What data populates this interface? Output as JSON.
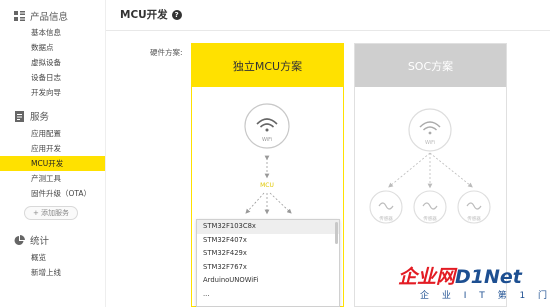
{
  "page": {
    "title": "MCU开发"
  },
  "sidebar": {
    "sections": [
      {
        "title": "产品信息",
        "icon": "grid-icon"
      },
      {
        "title": "服务",
        "icon": "document-icon"
      },
      {
        "title": "统计",
        "icon": "pie-chart-icon"
      }
    ],
    "items": [
      {
        "label": "基本信息"
      },
      {
        "label": "数据点"
      },
      {
        "label": "虚拟设备"
      },
      {
        "label": "设备日志"
      },
      {
        "label": "开发向导"
      },
      {
        "label": "应用配置"
      },
      {
        "label": "应用开发"
      },
      {
        "label": "MCU开发",
        "active": true
      },
      {
        "label": "产测工具"
      },
      {
        "label": "固件升级（OTA）"
      },
      {
        "label": "概览"
      },
      {
        "label": "新增上线"
      }
    ],
    "add_service": "+ 添加服务"
  },
  "hardware_label": "硬件方案:",
  "cards": [
    {
      "title": "独立MCU方案",
      "selected": true,
      "wifi_label": "WiFi",
      "mcu_label": "MCU"
    },
    {
      "title": "SOC方案",
      "selected": false,
      "wifi_label": "WiFi",
      "sensors": [
        "传感器",
        "传感器",
        "传感器"
      ]
    }
  ],
  "dropdown": {
    "options": [
      "STM32F103C8x",
      "STM32F407x",
      "STM32F429x",
      "STM32F767x",
      "ArduinoUNOWiFi",
      "..."
    ]
  },
  "watermark": {
    "text_red": "企业网",
    "text_blue": "D1Net",
    "subtitle": "企 业 I T 第 1 门 户"
  },
  "colors": {
    "accent": "#ffe100",
    "disabled": "#cfcfcf"
  }
}
